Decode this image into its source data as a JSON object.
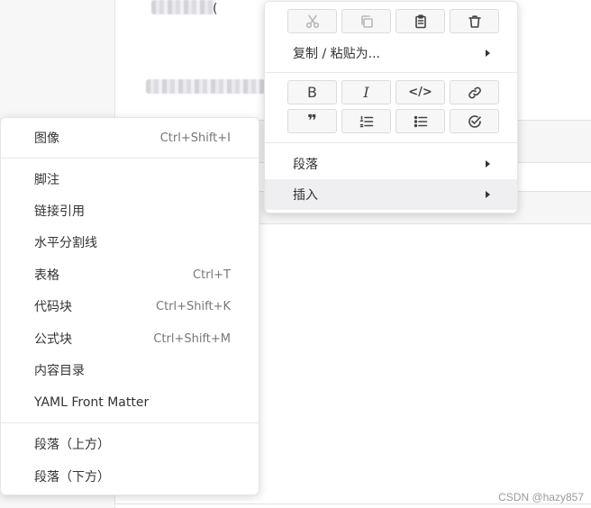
{
  "editor": {
    "blurred_tail_char": "("
  },
  "context_menu": {
    "toolbar_top": [
      {
        "icon": "cut-icon",
        "disabled": true
      },
      {
        "icon": "copy-icon",
        "disabled": true
      },
      {
        "icon": "paste-icon",
        "disabled": false
      },
      {
        "icon": "delete-icon",
        "disabled": false
      }
    ],
    "copy_paste_as": "复制 / 粘贴为...",
    "format_row_1": [
      {
        "icon": "bold-icon",
        "glyph": "B"
      },
      {
        "icon": "italic-icon",
        "glyph": "I"
      },
      {
        "icon": "code-icon",
        "glyph": "</>"
      },
      {
        "icon": "link-icon",
        "glyph": ""
      }
    ],
    "format_row_2": [
      {
        "icon": "quote-icon",
        "glyph": "❞"
      },
      {
        "icon": "ordered-list-icon",
        "glyph": ""
      },
      {
        "icon": "unordered-list-icon",
        "glyph": ""
      },
      {
        "icon": "task-list-icon",
        "glyph": ""
      }
    ],
    "paragraph": "段落",
    "insert": "插入"
  },
  "insert_submenu": {
    "items": [
      {
        "label": "图像",
        "shortcut": "Ctrl+Shift+I"
      },
      {
        "label": "脚注",
        "shortcut": ""
      },
      {
        "label": "链接引用",
        "shortcut": ""
      },
      {
        "label": "水平分割线",
        "shortcut": ""
      },
      {
        "label": "表格",
        "shortcut": "Ctrl+T"
      },
      {
        "label": "代码块",
        "shortcut": "Ctrl+Shift+K"
      },
      {
        "label": "公式块",
        "shortcut": "Ctrl+Shift+M"
      },
      {
        "label": "内容目录",
        "shortcut": ""
      },
      {
        "label": "YAML Front Matter",
        "shortcut": ""
      },
      {
        "label": "段落（上方）",
        "shortcut": ""
      },
      {
        "label": "段落（下方）",
        "shortcut": ""
      }
    ]
  },
  "watermark": "CSDN @hazy857"
}
